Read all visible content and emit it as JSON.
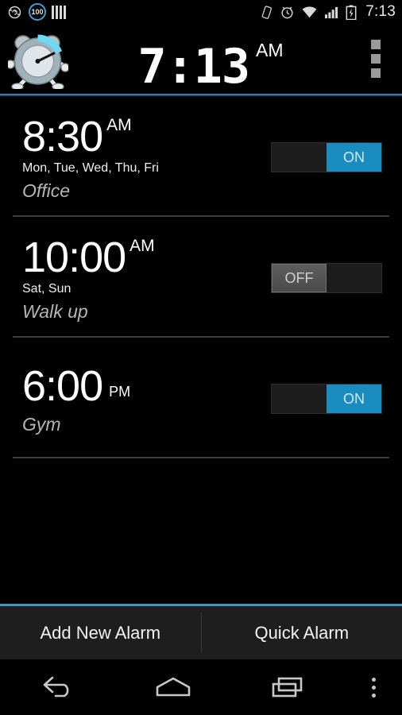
{
  "statusbar": {
    "left_icons": [
      {
        "name": "rotation-lock-icon"
      },
      {
        "name": "battery-percent-icon",
        "value": "100"
      },
      {
        "name": "signal-bars-icon"
      }
    ],
    "right_icons": [
      {
        "name": "vibrate-icon"
      },
      {
        "name": "alarm-set-icon"
      },
      {
        "name": "wifi-icon"
      },
      {
        "name": "cellular-signal-icon"
      },
      {
        "name": "battery-charging-icon"
      }
    ],
    "clock": "7:13"
  },
  "header": {
    "app_icon": "running-alarm-clock-icon",
    "time": "7:13",
    "ampm": "AM",
    "overflow_menu": "overflow-menu-icon",
    "accent_color": "#2a6a9e"
  },
  "alarms": [
    {
      "time": "8:30",
      "ampm": "AM",
      "ampm_style": "superscript",
      "days": "Mon, Tue, Wed, Thu, Fri",
      "label": "Office",
      "enabled": true,
      "toggle_label": "ON"
    },
    {
      "time": "10:00",
      "ampm": "AM",
      "ampm_style": "superscript",
      "days": "Sat, Sun",
      "label": "Walk up",
      "enabled": false,
      "toggle_label": "OFF"
    },
    {
      "time": "6:00",
      "ampm": "PM",
      "ampm_style": "baseline",
      "days": "",
      "label": "Gym",
      "enabled": true,
      "toggle_label": "ON"
    }
  ],
  "bottom": {
    "add_alarm_label": "Add New Alarm",
    "quick_alarm_label": "Quick Alarm"
  },
  "navbar": {
    "back": "back-icon",
    "home": "home-icon",
    "recents": "recents-icon",
    "menu": "menu-icon"
  },
  "colors": {
    "accent_blue": "#1a8cc0",
    "header_line": "#4a90bd",
    "background": "#000000"
  }
}
